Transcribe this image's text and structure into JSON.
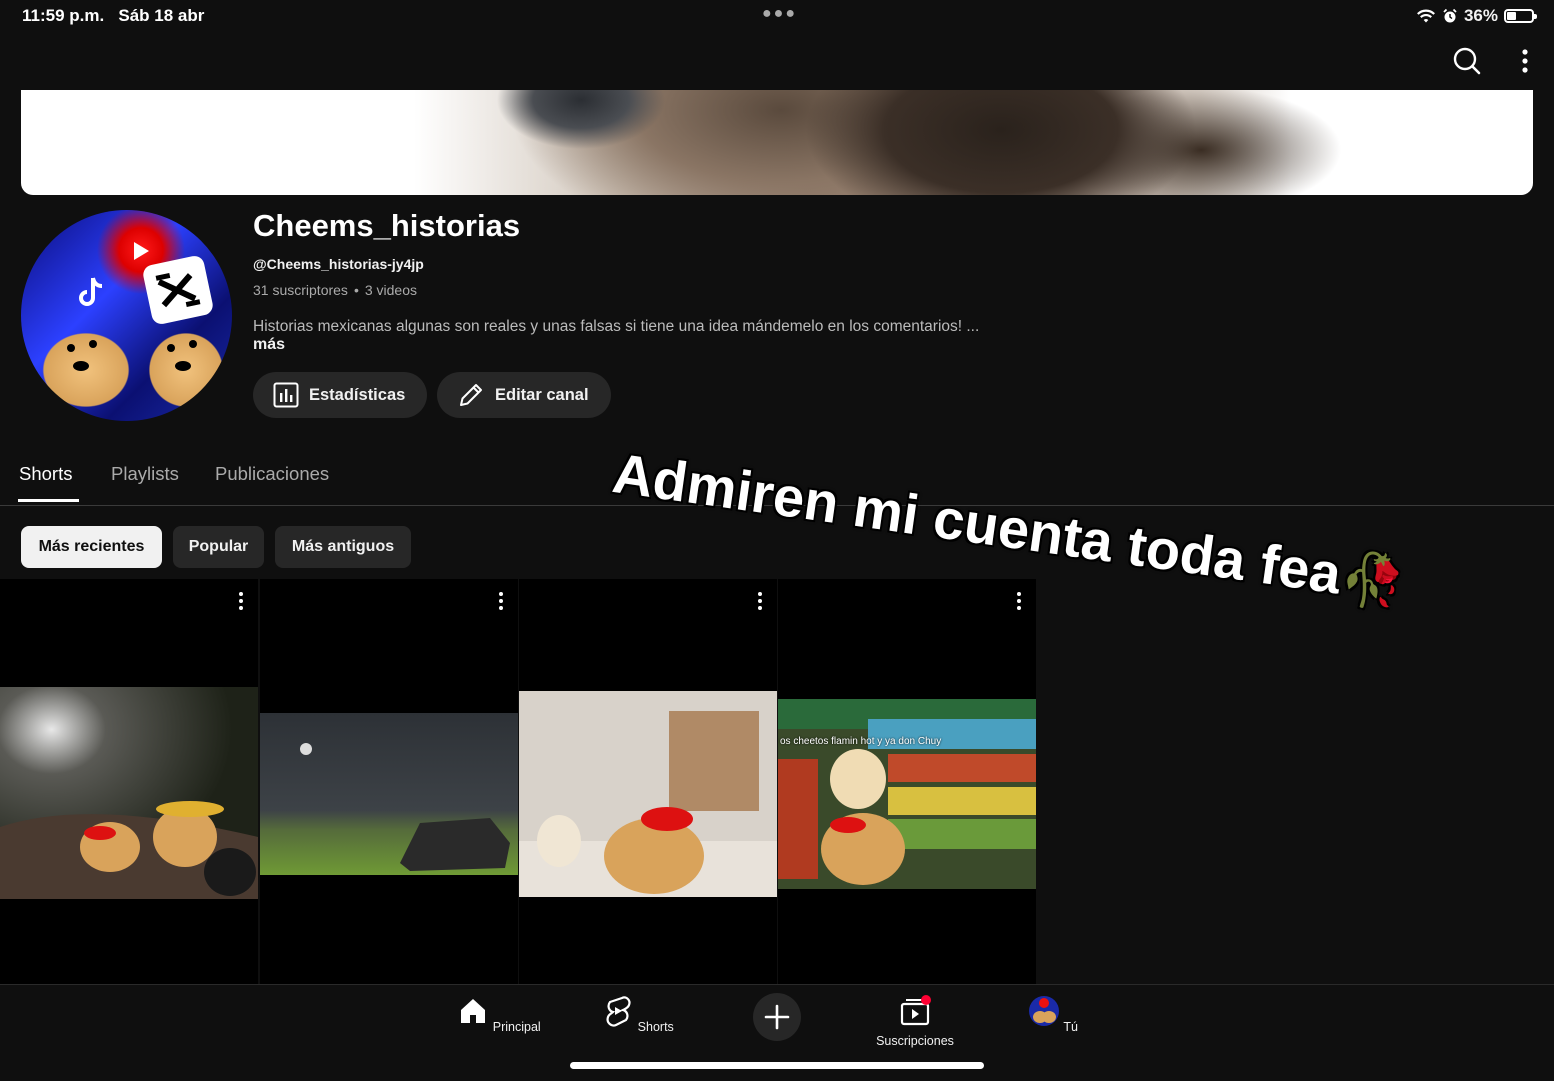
{
  "status": {
    "time": "11:59 p.m.",
    "date": "Sáb 18 abr",
    "battery": "36%",
    "battery_level": 0.36
  },
  "channel": {
    "name": "Cheems_historias",
    "handle": "@Cheems_historias-jy4jp",
    "subscribers": "31 suscriptores",
    "separator": "•",
    "videos": "3 videos",
    "description": "Historias mexicanas algunas son reales y unas falsas si tiene una idea mándemelo en los comentarios! ...",
    "more_label": "más"
  },
  "actions": {
    "stats_label": "Estadísticas",
    "edit_label": "Editar canal"
  },
  "tabs": [
    {
      "label": "Shorts"
    },
    {
      "label": "Playlists"
    },
    {
      "label": "Publicaciones"
    }
  ],
  "filters": [
    {
      "label": "Más recientes"
    },
    {
      "label": "Popular"
    },
    {
      "label": "Más antiguos"
    }
  ],
  "shorts": [
    {
      "caption": ""
    },
    {
      "caption": ""
    },
    {
      "caption": ""
    },
    {
      "caption": "os cheetos flamin hot y ya don Chuy"
    }
  ],
  "overlay": {
    "text": "Admiren mi cuenta toda fea",
    "emoji": "🥀"
  },
  "bottom_nav": [
    {
      "label": "Principal"
    },
    {
      "label": "Shorts"
    },
    {
      "label": "Suscripciones"
    },
    {
      "label": "Tú"
    }
  ],
  "colors": {
    "background": "#0f0f0f",
    "chip_bg": "#272727",
    "active_chip_bg": "#f1f1f1",
    "notification_dot": "#ff0033"
  }
}
